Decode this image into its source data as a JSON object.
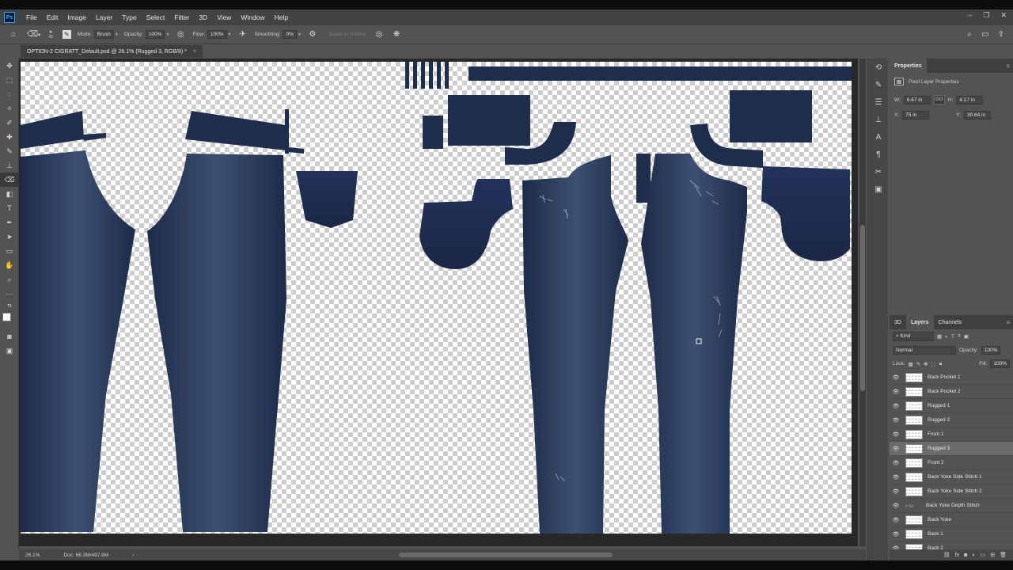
{
  "menu": {
    "items": [
      "File",
      "Edit",
      "Image",
      "Layer",
      "Type",
      "Select",
      "Filter",
      "3D",
      "View",
      "Window",
      "Help"
    ],
    "window_controls": [
      "–",
      "❐",
      "✕"
    ]
  },
  "options": {
    "brush_size": "43",
    "mode_label": "Mode:",
    "mode_value": "Brush",
    "opacity_label": "Opacity:",
    "opacity_value": "100%",
    "flow_label": "Flow:",
    "flow_value": "100%",
    "smoothing_label": "Smoothing:",
    "smoothing_value": "0%",
    "erase_history": "Erase to History"
  },
  "document": {
    "tab_title": "OPTION-2 CIGRATT_Default.psd @ 26.1% (Rugged 3, RGB/8) *",
    "close": "×"
  },
  "status": {
    "zoom": "26.1%",
    "doc": "Doc: 66.3M/497.6M",
    "arrow": "›"
  },
  "properties": {
    "title": "Properties",
    "subtitle": "Pixel Layer Properties",
    "w_label": "W:",
    "w_value": "6.67 in",
    "link": "GO",
    "h_label": "H:",
    "h_value": "4.17 in",
    "x_label": "X:",
    "x_value": "75 in",
    "y_label": "Y:",
    "y_value": "30.64 in"
  },
  "layers_panel": {
    "tabs": [
      "3D",
      "Layers",
      "Channels"
    ],
    "filter": "Kind",
    "blend": "Normal",
    "opacity_label": "Opacity:",
    "opacity_value": "100%",
    "lock_label": "Lock:",
    "fill_label": "Fill:",
    "fill_value": "100%",
    "layers": [
      {
        "name": "Back Pocket 1",
        "selected": false,
        "group": false
      },
      {
        "name": "Back Pocket 2",
        "selected": false,
        "group": false
      },
      {
        "name": "Rugged 1",
        "selected": false,
        "group": false
      },
      {
        "name": "Rugged 2",
        "selected": false,
        "group": false
      },
      {
        "name": "Front 1",
        "selected": false,
        "group": false
      },
      {
        "name": "Rugged 3",
        "selected": true,
        "group": false
      },
      {
        "name": "Front 2",
        "selected": false,
        "group": false
      },
      {
        "name": "Back Yoke Side Stitch 1",
        "selected": false,
        "group": false
      },
      {
        "name": "Back Yoke Side Stitch 2",
        "selected": false,
        "group": false
      },
      {
        "name": "Back Yoke Depth Stitch",
        "selected": false,
        "group": true
      },
      {
        "name": "Back Yoke",
        "selected": false,
        "group": false
      },
      {
        "name": "Back 1",
        "selected": false,
        "group": false
      },
      {
        "name": "Back 2",
        "selected": false,
        "group": false
      }
    ]
  },
  "colors": {
    "denim": "#1f2e4d",
    "denim_light": "#3a4d6e",
    "accent_ps": "#31a8ff"
  }
}
